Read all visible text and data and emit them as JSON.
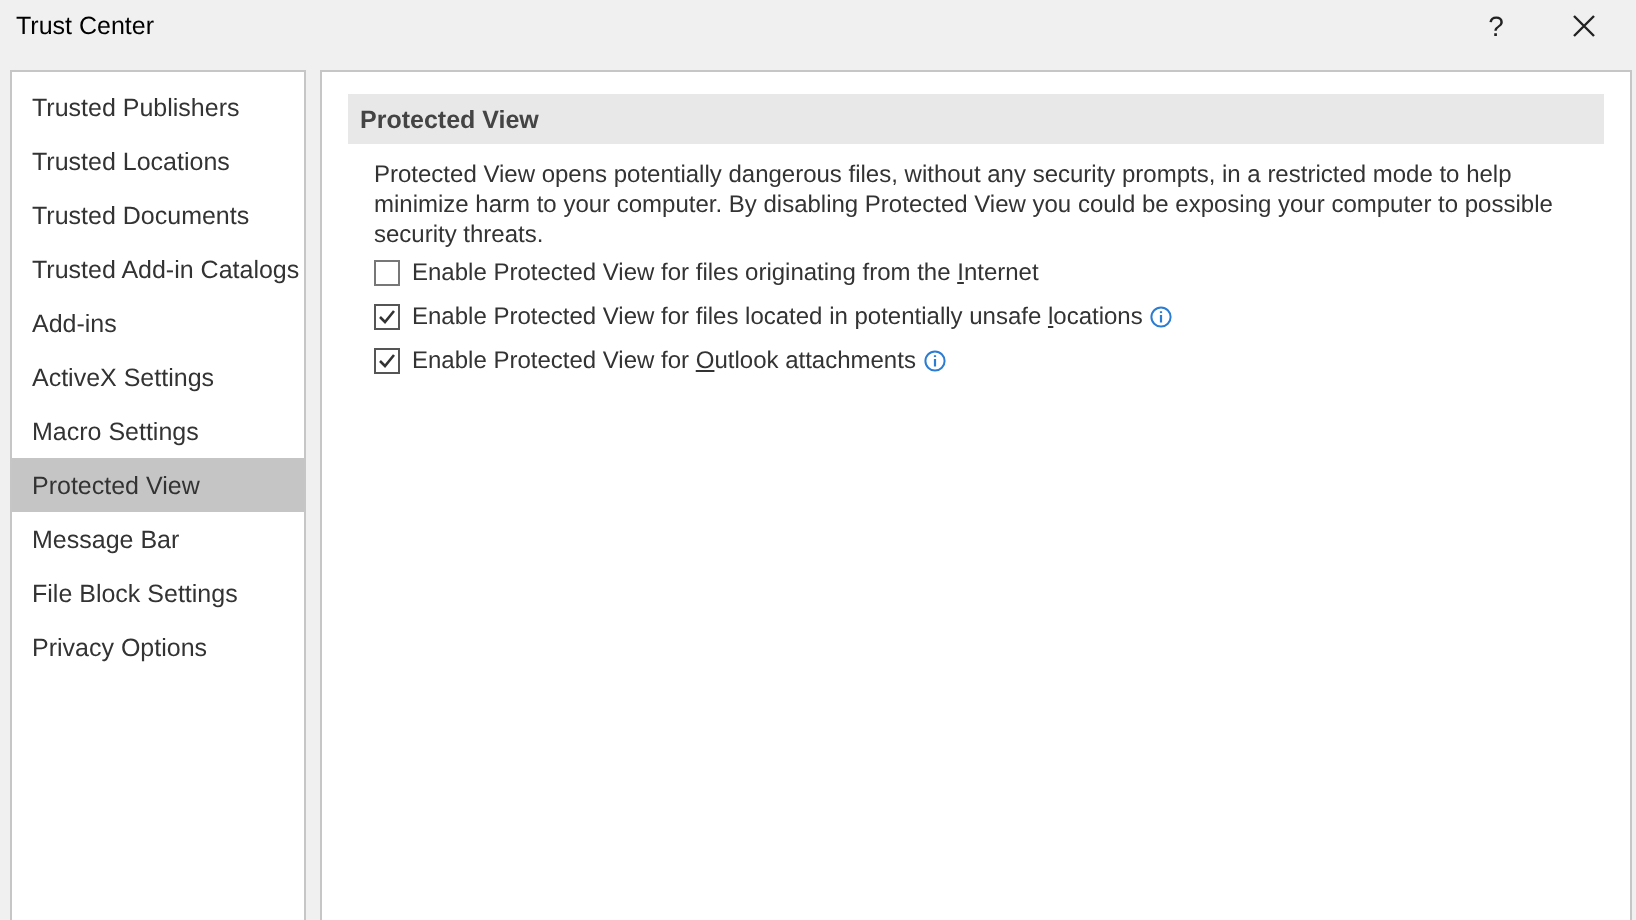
{
  "window": {
    "title": "Trust Center",
    "help": "?"
  },
  "sidebar": {
    "items": [
      {
        "label": "Trusted Publishers",
        "selected": false
      },
      {
        "label": "Trusted Locations",
        "selected": false
      },
      {
        "label": "Trusted Documents",
        "selected": false
      },
      {
        "label": "Trusted Add-in Catalogs",
        "selected": false
      },
      {
        "label": "Add-ins",
        "selected": false
      },
      {
        "label": "ActiveX Settings",
        "selected": false
      },
      {
        "label": "Macro Settings",
        "selected": false
      },
      {
        "label": "Protected View",
        "selected": true
      },
      {
        "label": "Message Bar",
        "selected": false
      },
      {
        "label": "File Block Settings",
        "selected": false
      },
      {
        "label": "Privacy Options",
        "selected": false
      }
    ]
  },
  "section": {
    "title": "Protected View",
    "description": "Protected View opens potentially dangerous files, without any security prompts, in a restricted mode to help minimize harm to your computer. By disabling Protected View you could be exposing your computer to possible security threats.",
    "options": [
      {
        "label_before": "Enable Protected View for files originating from the ",
        "access_key": "I",
        "label_after": "nternet",
        "checked": false,
        "info": false
      },
      {
        "label_before": "Enable Protected View for files located in potentially unsafe ",
        "access_key": "l",
        "label_after": "ocations",
        "checked": true,
        "info": true
      },
      {
        "label_before": "Enable Protected View for ",
        "access_key": "O",
        "label_after": "utlook attachments",
        "checked": true,
        "info": true
      }
    ]
  }
}
